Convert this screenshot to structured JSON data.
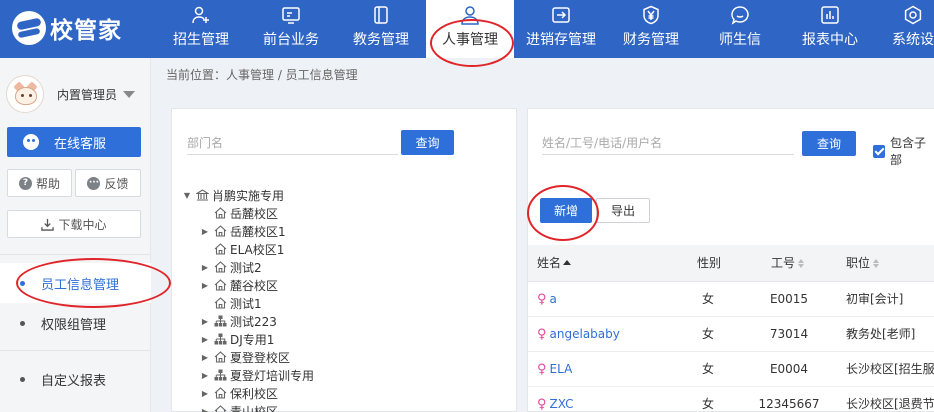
{
  "app": {
    "logo_text": "校管家"
  },
  "nav": {
    "items": [
      {
        "label": "招生管理",
        "icon": "user-plus-icon"
      },
      {
        "label": "前台业务",
        "icon": "monitor-icon"
      },
      {
        "label": "教务管理",
        "icon": "book-icon"
      },
      {
        "label": "人事管理",
        "icon": "person-icon",
        "active": true
      },
      {
        "label": "进销存管理",
        "icon": "inbox-arrow-icon"
      },
      {
        "label": "财务管理",
        "icon": "yen-shield-icon"
      },
      {
        "label": "师生信",
        "icon": "chat-bubble-icon"
      },
      {
        "label": "报表中心",
        "icon": "bar-chart-icon"
      },
      {
        "label": "系统设",
        "icon": "settings-icon"
      }
    ]
  },
  "sidebar": {
    "user_name": "内置管理员",
    "service_label": "在线客服",
    "help_label": "帮助",
    "feedback_label": "反馈",
    "download_label": "下载中心",
    "menu": [
      {
        "label": "员工信息管理",
        "active": true
      },
      {
        "label": "权限组管理"
      },
      {
        "label": "自定义报表"
      }
    ]
  },
  "breadcrumb": "当前位置：人事管理 / 员工信息管理",
  "dept_panel": {
    "search_placeholder": "部门名",
    "query_label": "查询",
    "tree": [
      {
        "label": "肖鹏实施专用",
        "level": 0,
        "expand": "open",
        "icon": "bank-icon"
      },
      {
        "label": "岳麓校区",
        "level": 1,
        "expand": "none",
        "icon": "home-icon"
      },
      {
        "label": "岳麓校区1",
        "level": 1,
        "expand": "closed",
        "icon": "home-icon"
      },
      {
        "label": "ELA校区1",
        "level": 1,
        "expand": "none",
        "icon": "home-icon"
      },
      {
        "label": "测试2",
        "level": 1,
        "expand": "closed",
        "icon": "home-icon"
      },
      {
        "label": "麓谷校区",
        "level": 1,
        "expand": "closed",
        "icon": "home-icon"
      },
      {
        "label": "测试1",
        "level": 1,
        "expand": "none",
        "icon": "home-icon"
      },
      {
        "label": "测试223",
        "level": 1,
        "expand": "closed",
        "icon": "org-icon"
      },
      {
        "label": "DJ专用1",
        "level": 1,
        "expand": "closed",
        "icon": "org-icon"
      },
      {
        "label": "夏登登校区",
        "level": 1,
        "expand": "closed",
        "icon": "home-icon"
      },
      {
        "label": "夏登灯培训专用",
        "level": 1,
        "expand": "closed",
        "icon": "org-icon"
      },
      {
        "label": "保利校区",
        "level": 1,
        "expand": "closed",
        "icon": "home-icon"
      },
      {
        "label": "青山校区",
        "level": 1,
        "expand": "closed",
        "icon": "home-icon"
      }
    ]
  },
  "staff_panel": {
    "search_placeholder": "姓名/工号/电话/用户名",
    "query_label": "查询",
    "include_sub_label": "包含子部",
    "add_label": "新增",
    "export_label": "导出",
    "columns": [
      "姓名",
      "性别",
      "工号",
      "职位"
    ],
    "rows": [
      {
        "name": "a",
        "gender": "女",
        "id": "E0015",
        "position": "初审[会计]"
      },
      {
        "name": "angelababy",
        "gender": "女",
        "id": "73014",
        "position": "教务处[老师]"
      },
      {
        "name": "ELA",
        "gender": "女",
        "id": "E0004",
        "position": "长沙校区[招生服"
      },
      {
        "name": "ZXC",
        "gender": "女",
        "id": "12345667",
        "position": "长沙校区[退费节"
      }
    ]
  }
}
